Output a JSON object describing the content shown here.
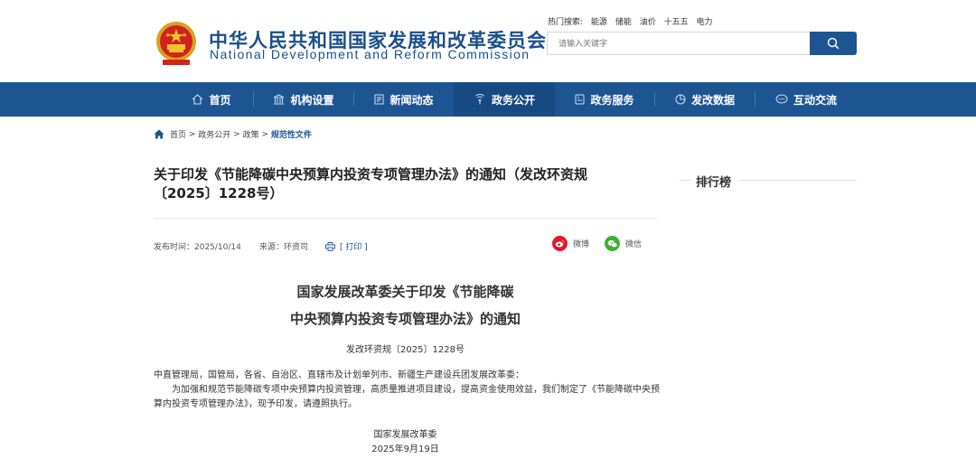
{
  "header": {
    "cn_name": "中华人民共和国国家发展和改革委员会",
    "en_name": "National Development and Reform Commission",
    "hot_label": "热门搜索:",
    "hot_terms": [
      "能源",
      "储能",
      "油价",
      "十五五",
      "电力"
    ],
    "search_placeholder": "请输入关键字"
  },
  "nav": {
    "items": [
      {
        "label": "首页",
        "icon": "home-icon"
      },
      {
        "label": "机构设置",
        "icon": "institution-icon"
      },
      {
        "label": "新闻动态",
        "icon": "news-icon"
      },
      {
        "label": "政务公开",
        "icon": "broadcast-icon",
        "active": true
      },
      {
        "label": "政务服务",
        "icon": "service-icon"
      },
      {
        "label": "发改数据",
        "icon": "pie-chart-icon"
      },
      {
        "label": "互动交流",
        "icon": "chat-icon"
      }
    ]
  },
  "breadcrumb": {
    "items": [
      "首页",
      "政务公开",
      "政策"
    ],
    "sep": " > ",
    "current": "规范性文件"
  },
  "article": {
    "title": "关于印发《节能降碳中央预算内投资专项管理办法》的通知（发改环资规〔2025〕1228号）",
    "publish_time": "发布时间：2025/10/14",
    "source": "来源：环资司",
    "print_label": "[ 打印 ]",
    "share_weibo": "微博",
    "share_wechat": "微信",
    "doc_heading_line1": "国家发展改革委关于印发《节能降碳",
    "doc_heading_line2": "中央预算内投资专项管理办法》的通知",
    "doc_number": "发改环资规〔2025〕1228号",
    "recipients": "中直管理局，国管局，各省、自治区、直辖市及计划单列市、新疆生产建设兵团发展改革委：",
    "body": "为加强和规范节能降碳专项中央预算内投资管理，高质量推进项目建设，提高资金使用效益，我们制定了《节能降碳中央预算内投资专项管理办法》，现予印发，请遵照执行。",
    "signer": "国家发展改革委",
    "date": "2025年9月19日"
  },
  "sidebar": {
    "rank_title": "排行榜"
  },
  "colors": {
    "brand_blue": "#1d5593",
    "nav_active": "#174a82",
    "weibo_red": "#e6162d",
    "wechat_green": "#3cb034"
  }
}
